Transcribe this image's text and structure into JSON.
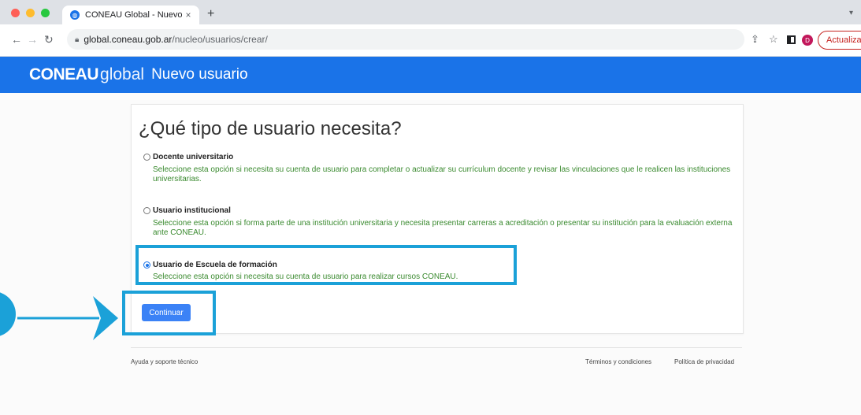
{
  "browser": {
    "tab_title": "CONEAU Global - Nuevo usuar",
    "tab_close": "×",
    "new_tab": "+",
    "url_host": "global.coneau.gob.ar",
    "url_path": "/nucleo/usuarios/crear/",
    "profile_initial": "D",
    "update_label": "Actualizar"
  },
  "header": {
    "logo_bold": "CONEAU",
    "logo_light": "global",
    "title": "Nuevo usuario"
  },
  "main": {
    "question": "¿Qué tipo de usuario necesita?",
    "options": [
      {
        "label": "Docente universitario",
        "description": "Seleccione esta opción si necesita su cuenta de usuario para completar o actualizar su currículum docente y revisar las vinculaciones que le realicen las instituciones universitarias.",
        "selected": false
      },
      {
        "label": "Usuario institucional",
        "description": "Seleccione esta opción si forma parte de una institución universitaria y necesita presentar carreras a acreditación o presentar su institución para la evaluación externa ante CONEAU.",
        "selected": false
      },
      {
        "label": "Usuario de Escuela de formación",
        "description": "Seleccione esta opción si necesita su cuenta de usuario para realizar cursos CONEAU.",
        "selected": true
      }
    ],
    "continue_label": "Continuar"
  },
  "footer": {
    "help": "Ayuda y soporte técnico",
    "terms": "Términos y condiciones",
    "privacy": "Política de privacidad"
  },
  "colors": {
    "brand_blue": "#1a73e8",
    "annotation_blue": "#1ba1d8",
    "description_green": "#3a8a2f",
    "button_blue": "#3b82f6"
  }
}
